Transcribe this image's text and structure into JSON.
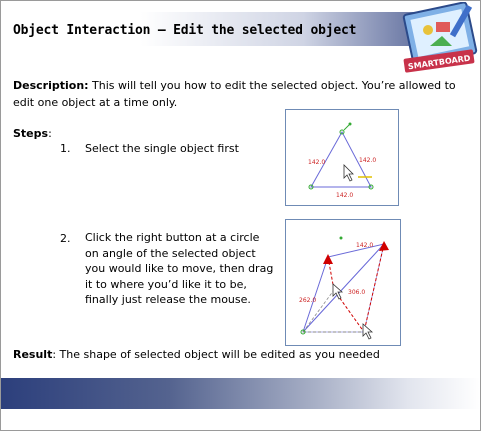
{
  "header": {
    "title": "Object Interaction – Edit the selected object"
  },
  "logo": {
    "label": "SMARTBOARD"
  },
  "description": {
    "label": "Description:",
    "text": " This will tell you how to edit the selected object. You’re allowed to edit one object at a time only."
  },
  "steps": {
    "label": "Steps",
    "colon": ":",
    "items": [
      {
        "number": "1.",
        "text": "Select the single object first"
      },
      {
        "number": "2.",
        "text": "Click the right button at a circle on angle of the selected object you would like to move, then drag it to where you’d like it to be, finally just release the mouse."
      }
    ]
  },
  "figure1": {
    "labels": [
      "142.0",
      "142.0",
      "142.0"
    ]
  },
  "figure2": {
    "labels": [
      "142.0",
      "262.0",
      "306.0"
    ]
  },
  "result": {
    "label": "Result",
    "text": ": The shape of selected object will be edited as you needed"
  },
  "colors": {
    "accent": "#2c3f7c",
    "edit_arrow": "#d00000",
    "selection_handle": "#33aa33"
  }
}
